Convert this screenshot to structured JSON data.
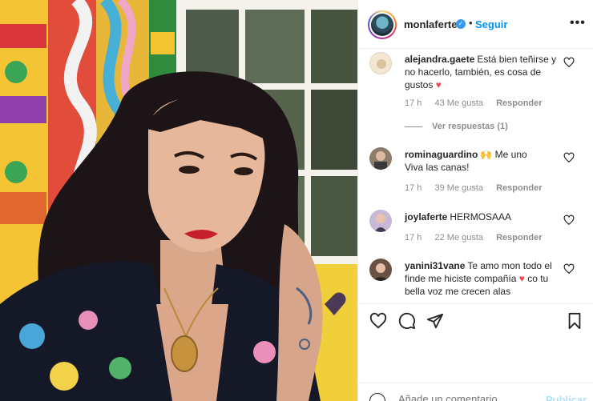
{
  "post": {
    "username": "monlaferte",
    "verified": true,
    "separator": "•",
    "follow_label": "Seguir",
    "more_label": "•••"
  },
  "comments": [
    {
      "username": "alejandra.gaete",
      "text": "Está bien teñirse y no hacerlo, también, es cosa de gustos",
      "emoji": "♥",
      "time": "17 h",
      "likes": "43 Me gusta",
      "reply": "Responder",
      "view_replies": "Ver respuestas (1)"
    },
    {
      "username": "rominaguardino",
      "text": "Me uno",
      "emoji": "🙌",
      "text2": "Viva las canas!",
      "time": "17 h",
      "likes": "39 Me gusta",
      "reply": "Responder"
    },
    {
      "username": "joylaferte",
      "text": "HERMOSAAA",
      "time": "17 h",
      "likes": "22 Me gusta",
      "reply": "Responder"
    },
    {
      "username": "yanini31vane",
      "text": "Te amo mon todo el finde me hiciste compañía",
      "emoji": "♥",
      "text2": "co tu bella voz me crecen alas"
    }
  ],
  "footer": {
    "comment_placeholder": "Añade un comentario...",
    "publish_label": "Publicar"
  },
  "icons": {
    "like": "heart-icon",
    "comment": "comment-icon",
    "share": "paper-plane-icon",
    "save": "bookmark-icon",
    "more": "more-options-icon",
    "emoji": "emoji-icon"
  },
  "colors": {
    "accent": "#0095f6",
    "heart": "#ed4956",
    "muted": "#8e8e8e",
    "text": "#262626"
  }
}
